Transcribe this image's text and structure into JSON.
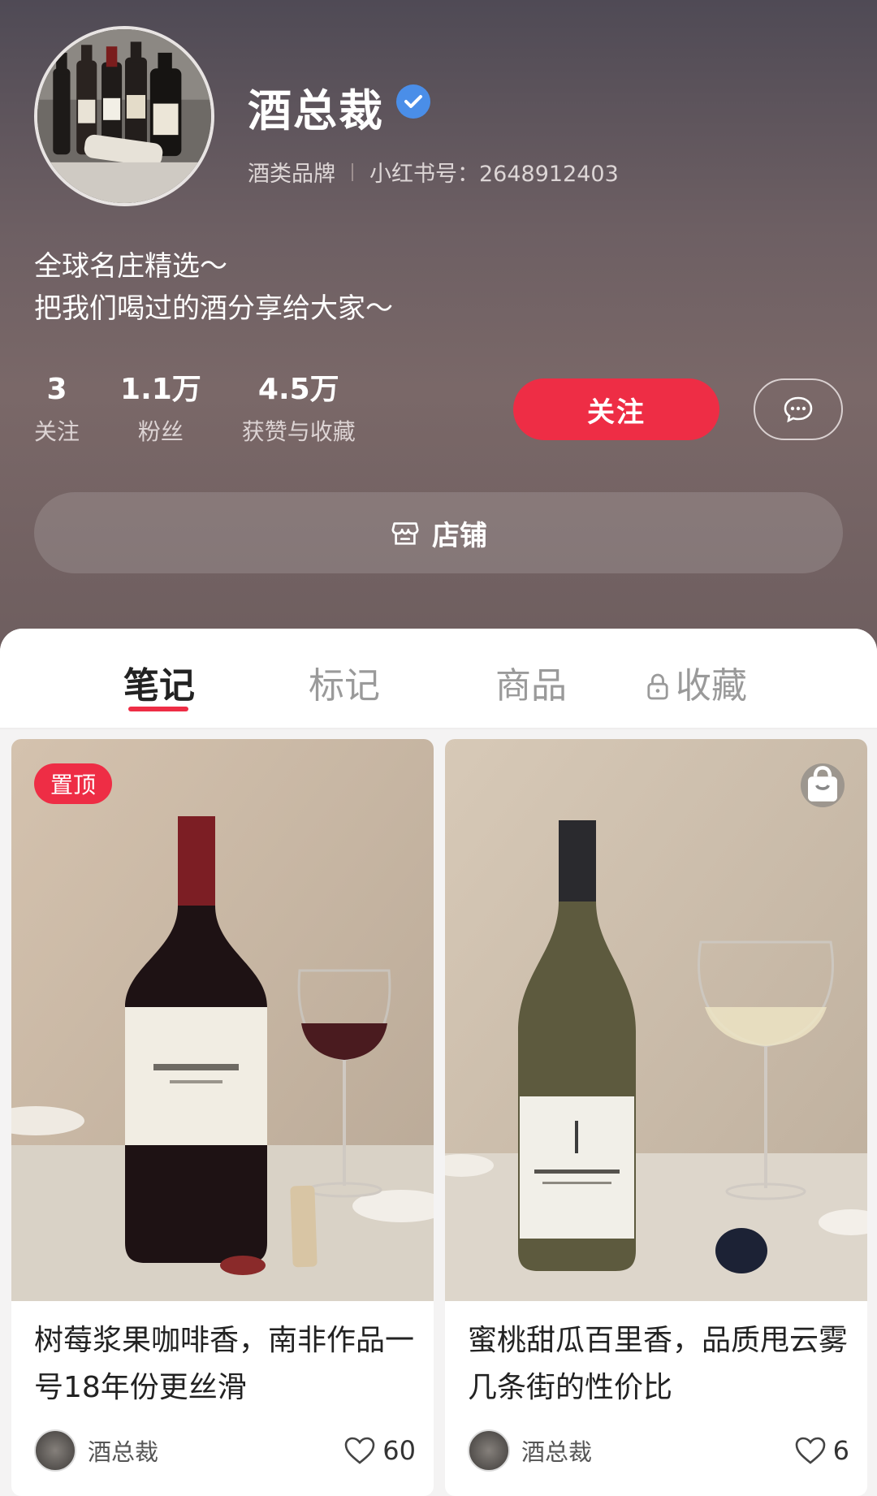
{
  "profile": {
    "name": "酒总裁",
    "category": "酒类品牌",
    "red_id": "小红书号：2648912403",
    "bio_line1": "全球名庄精选～",
    "bio_line2": "把我们喝过的酒分享给大家～"
  },
  "stats": [
    {
      "value": "3",
      "label": "关注"
    },
    {
      "value": "1.1万",
      "label": "粉丝"
    },
    {
      "value": "4.5万",
      "label": "获赞与收藏"
    }
  ],
  "actions": {
    "follow_label": "关注",
    "shop_label": "店铺"
  },
  "tabs": [
    {
      "label": "笔记",
      "active": true
    },
    {
      "label": "标记",
      "active": false
    },
    {
      "label": "商品",
      "active": false
    },
    {
      "label": "收藏",
      "active": false,
      "locked": true
    }
  ],
  "notes": [
    {
      "badge": "置顶",
      "title": "树莓浆果咖啡香，南非作品一号18年份更丝滑",
      "author": "酒总裁",
      "likes": "60"
    },
    {
      "badge": "",
      "title": "蜜桃甜瓜百里香，品质甩云雾几条街的性价比",
      "author": "酒总裁",
      "likes": "6"
    }
  ],
  "colors": {
    "accent": "#ee2d45",
    "verified": "#4a8ee8"
  }
}
